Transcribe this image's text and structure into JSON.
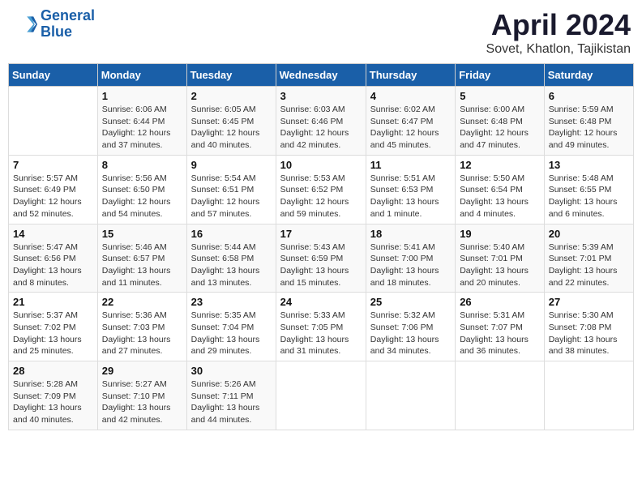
{
  "logo": {
    "line1": "General",
    "line2": "Blue"
  },
  "title": "April 2024",
  "subtitle": "Sovet, Khatlon, Tajikistan",
  "weekdays": [
    "Sunday",
    "Monday",
    "Tuesday",
    "Wednesday",
    "Thursday",
    "Friday",
    "Saturday"
  ],
  "weeks": [
    [
      {
        "day": "",
        "info": ""
      },
      {
        "day": "1",
        "info": "Sunrise: 6:06 AM\nSunset: 6:44 PM\nDaylight: 12 hours\nand 37 minutes."
      },
      {
        "day": "2",
        "info": "Sunrise: 6:05 AM\nSunset: 6:45 PM\nDaylight: 12 hours\nand 40 minutes."
      },
      {
        "day": "3",
        "info": "Sunrise: 6:03 AM\nSunset: 6:46 PM\nDaylight: 12 hours\nand 42 minutes."
      },
      {
        "day": "4",
        "info": "Sunrise: 6:02 AM\nSunset: 6:47 PM\nDaylight: 12 hours\nand 45 minutes."
      },
      {
        "day": "5",
        "info": "Sunrise: 6:00 AM\nSunset: 6:48 PM\nDaylight: 12 hours\nand 47 minutes."
      },
      {
        "day": "6",
        "info": "Sunrise: 5:59 AM\nSunset: 6:48 PM\nDaylight: 12 hours\nand 49 minutes."
      }
    ],
    [
      {
        "day": "7",
        "info": "Sunrise: 5:57 AM\nSunset: 6:49 PM\nDaylight: 12 hours\nand 52 minutes."
      },
      {
        "day": "8",
        "info": "Sunrise: 5:56 AM\nSunset: 6:50 PM\nDaylight: 12 hours\nand 54 minutes."
      },
      {
        "day": "9",
        "info": "Sunrise: 5:54 AM\nSunset: 6:51 PM\nDaylight: 12 hours\nand 57 minutes."
      },
      {
        "day": "10",
        "info": "Sunrise: 5:53 AM\nSunset: 6:52 PM\nDaylight: 12 hours\nand 59 minutes."
      },
      {
        "day": "11",
        "info": "Sunrise: 5:51 AM\nSunset: 6:53 PM\nDaylight: 13 hours\nand 1 minute."
      },
      {
        "day": "12",
        "info": "Sunrise: 5:50 AM\nSunset: 6:54 PM\nDaylight: 13 hours\nand 4 minutes."
      },
      {
        "day": "13",
        "info": "Sunrise: 5:48 AM\nSunset: 6:55 PM\nDaylight: 13 hours\nand 6 minutes."
      }
    ],
    [
      {
        "day": "14",
        "info": "Sunrise: 5:47 AM\nSunset: 6:56 PM\nDaylight: 13 hours\nand 8 minutes."
      },
      {
        "day": "15",
        "info": "Sunrise: 5:46 AM\nSunset: 6:57 PM\nDaylight: 13 hours\nand 11 minutes."
      },
      {
        "day": "16",
        "info": "Sunrise: 5:44 AM\nSunset: 6:58 PM\nDaylight: 13 hours\nand 13 minutes."
      },
      {
        "day": "17",
        "info": "Sunrise: 5:43 AM\nSunset: 6:59 PM\nDaylight: 13 hours\nand 15 minutes."
      },
      {
        "day": "18",
        "info": "Sunrise: 5:41 AM\nSunset: 7:00 PM\nDaylight: 13 hours\nand 18 minutes."
      },
      {
        "day": "19",
        "info": "Sunrise: 5:40 AM\nSunset: 7:01 PM\nDaylight: 13 hours\nand 20 minutes."
      },
      {
        "day": "20",
        "info": "Sunrise: 5:39 AM\nSunset: 7:01 PM\nDaylight: 13 hours\nand 22 minutes."
      }
    ],
    [
      {
        "day": "21",
        "info": "Sunrise: 5:37 AM\nSunset: 7:02 PM\nDaylight: 13 hours\nand 25 minutes."
      },
      {
        "day": "22",
        "info": "Sunrise: 5:36 AM\nSunset: 7:03 PM\nDaylight: 13 hours\nand 27 minutes."
      },
      {
        "day": "23",
        "info": "Sunrise: 5:35 AM\nSunset: 7:04 PM\nDaylight: 13 hours\nand 29 minutes."
      },
      {
        "day": "24",
        "info": "Sunrise: 5:33 AM\nSunset: 7:05 PM\nDaylight: 13 hours\nand 31 minutes."
      },
      {
        "day": "25",
        "info": "Sunrise: 5:32 AM\nSunset: 7:06 PM\nDaylight: 13 hours\nand 34 minutes."
      },
      {
        "day": "26",
        "info": "Sunrise: 5:31 AM\nSunset: 7:07 PM\nDaylight: 13 hours\nand 36 minutes."
      },
      {
        "day": "27",
        "info": "Sunrise: 5:30 AM\nSunset: 7:08 PM\nDaylight: 13 hours\nand 38 minutes."
      }
    ],
    [
      {
        "day": "28",
        "info": "Sunrise: 5:28 AM\nSunset: 7:09 PM\nDaylight: 13 hours\nand 40 minutes."
      },
      {
        "day": "29",
        "info": "Sunrise: 5:27 AM\nSunset: 7:10 PM\nDaylight: 13 hours\nand 42 minutes."
      },
      {
        "day": "30",
        "info": "Sunrise: 5:26 AM\nSunset: 7:11 PM\nDaylight: 13 hours\nand 44 minutes."
      },
      {
        "day": "",
        "info": ""
      },
      {
        "day": "",
        "info": ""
      },
      {
        "day": "",
        "info": ""
      },
      {
        "day": "",
        "info": ""
      }
    ]
  ]
}
